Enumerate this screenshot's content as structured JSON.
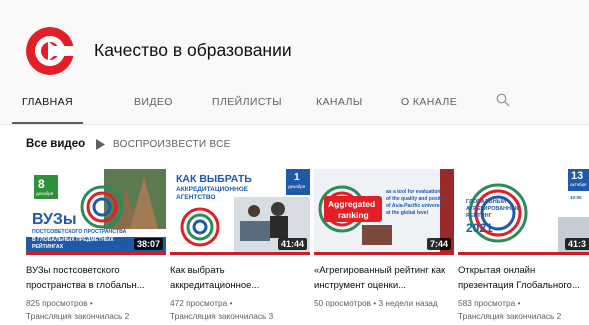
{
  "channel": {
    "name": "Качество в образовании",
    "brand_color": "#e31e24"
  },
  "tabs": [
    {
      "label": "ГЛАВНАЯ",
      "active": true
    },
    {
      "label": "ВИДЕО",
      "active": false
    },
    {
      "label": "ПЛЕЙЛИСТЫ",
      "active": false
    },
    {
      "label": "КАНАЛЫ",
      "active": false
    },
    {
      "label": "О КАНАЛЕ",
      "active": false
    }
  ],
  "search_icon": "search-icon",
  "section": {
    "title": "Все видео",
    "play_all_label": "ВОСПРОИЗВЕСТИ ВСЕ"
  },
  "videos": [
    {
      "title": "ВУЗы постсоветского пространства в глобальн...",
      "duration": "38:07",
      "views": "825 просмотров •",
      "status": "Трансляция закончилась 2",
      "thumb": {
        "date_day": "8",
        "date_month": "декабря",
        "heading": "ВУЗы",
        "subheading_1": "ПОСТСОВЕТСКОГО ПРОСТРАНСТВА",
        "subheading_2": "В ГЛОБАЛЬНЫХ ПРЕДМЕТНЫХ",
        "subheading_3": "РЕЙТИНГАХ"
      }
    },
    {
      "title": "Как выбрать аккредитационное...",
      "duration": "41:44",
      "views": "472 просмотра •",
      "status": "Трансляция закончилась 3",
      "thumb": {
        "heading_1": "КАК ВЫБРАТЬ",
        "heading_2": "АККРЕДИТАЦИОННОЕ",
        "heading_3": "АГЕНТСТВО",
        "date_day": "1",
        "date_month": "декабря"
      }
    },
    {
      "title": "«Агрегированный рейтинг как инструмент оценки...",
      "duration": "7:44",
      "views": "50 просмотров • 3 недели назад",
      "status": "",
      "thumb": {
        "badge_1": "Aggregated",
        "badge_2": "ranking",
        "line_1": "as a tool for evaluation",
        "line_2": "of the quality and position",
        "line_3": "of Asia-Pacific universi",
        "line_4": "at the global level"
      }
    },
    {
      "title": "Открытая онлайн презентация Глобального...",
      "duration": "41:3",
      "views": "583 просмотра •",
      "status": "Трансляция закончилась 2",
      "thumb": {
        "line_1": "ГЛОБАЛЬНЫЙ",
        "line_2": "АГРЕГИРОВАННЫЙ",
        "line_3": "РЕЙТИНГ",
        "year": "2021",
        "date_day": "13",
        "date_month": "октября",
        "time": "10:00"
      }
    }
  ]
}
